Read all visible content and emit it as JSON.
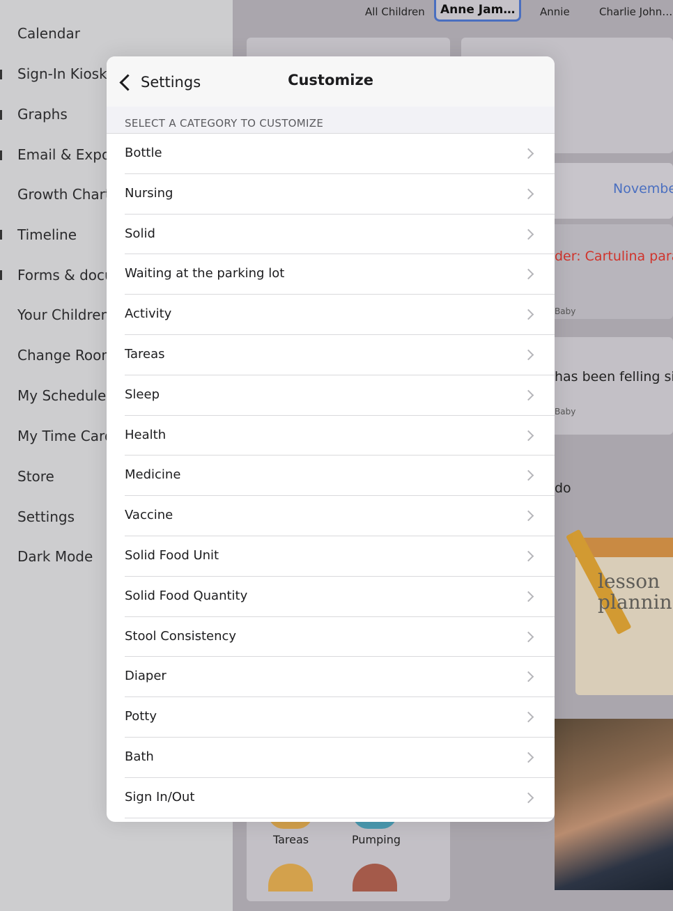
{
  "sidebar": {
    "items": [
      {
        "label": "Calendar"
      },
      {
        "label": "Sign-In Kiosk"
      },
      {
        "label": "Graphs"
      },
      {
        "label": "Email & Expor"
      },
      {
        "label": "Growth Chart"
      },
      {
        "label": "Timeline"
      },
      {
        "label": "Forms & docu"
      },
      {
        "label": "Your Children"
      },
      {
        "label": "Change Room"
      },
      {
        "label": "My Schedule"
      },
      {
        "label": "My Time Card"
      },
      {
        "label": "Store"
      },
      {
        "label": "Settings"
      },
      {
        "label": "Dark Mode"
      }
    ]
  },
  "children_tabs": [
    {
      "label": "All Children"
    },
    {
      "label": "Anne Jam…",
      "selected": true
    },
    {
      "label": "Annie"
    },
    {
      "label": "Charlie John…"
    }
  ],
  "background": {
    "month": "Novembe",
    "reminder": "der: Cartulina para",
    "baby1": "Baby",
    "felling": "has been felling si",
    "baby2": "Baby",
    "do": "do",
    "lesson_line1": "lesson",
    "lesson_line2": "planning",
    "tareas": "Tareas",
    "pumping": "Pumping"
  },
  "modal": {
    "back_label": "Settings",
    "title": "Customize",
    "section_header": "SELECT A CATEGORY TO CUSTOMIZE",
    "categories": [
      {
        "label": "Bottle"
      },
      {
        "label": "Nursing"
      },
      {
        "label": "Solid"
      },
      {
        "label": "Waiting at the parking lot"
      },
      {
        "label": "Activity"
      },
      {
        "label": "Tareas"
      },
      {
        "label": "Sleep"
      },
      {
        "label": "Health"
      },
      {
        "label": "Medicine"
      },
      {
        "label": "Vaccine"
      },
      {
        "label": "Solid Food Unit"
      },
      {
        "label": "Solid Food Quantity"
      },
      {
        "label": "Stool Consistency"
      },
      {
        "label": "Diaper"
      },
      {
        "label": "Potty"
      },
      {
        "label": "Bath"
      },
      {
        "label": "Sign In/Out"
      }
    ]
  },
  "colors": {
    "accent": "#4a6fc0",
    "reminder_red": "#d0342c",
    "month_blue": "#4a6fc0"
  }
}
